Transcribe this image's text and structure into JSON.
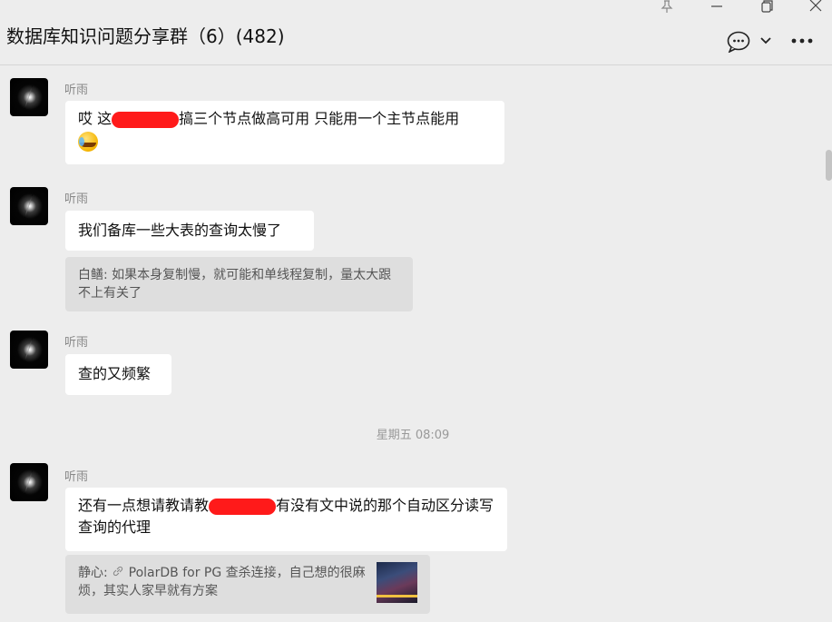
{
  "header": {
    "title": "数据库知识问题分享群（6）(482)"
  },
  "messages": [
    {
      "sender": "听雨",
      "text_before": "哎 这",
      "text_after": "搞三个节点做高可用  只能用一个主节点能用"
    },
    {
      "sender": "听雨",
      "text": "我们备库一些大表的查询太慢了",
      "quote": "白鳝: 如果本身复制慢，就可能和单线程复制，量太大跟不上有关了"
    },
    {
      "sender": "听雨",
      "text": "查的又频繁"
    },
    {
      "sender": "听雨",
      "text_before": "还有一点想请教请教",
      "text_after": "有没有文中说的那个自动区分读写查询的代理",
      "quote_prefix": "静心: ",
      "quote_text": "PolarDB for PG 查杀连接，自己想的很麻烦，其实人家早就有方案"
    }
  ],
  "timestamp": "星期五 08:09",
  "colors": {
    "background": "#ededed",
    "bubble": "#ffffff",
    "quote_bg": "#dedede",
    "redaction": "#ff1a1a"
  },
  "icons": {
    "pin": "pin-icon",
    "minimize": "minimize-icon",
    "restore": "restore-icon",
    "close": "close-icon",
    "chat": "chat-bubble-icon",
    "chevron": "chevron-down-icon",
    "more": "more-icon",
    "link": "link-icon"
  }
}
